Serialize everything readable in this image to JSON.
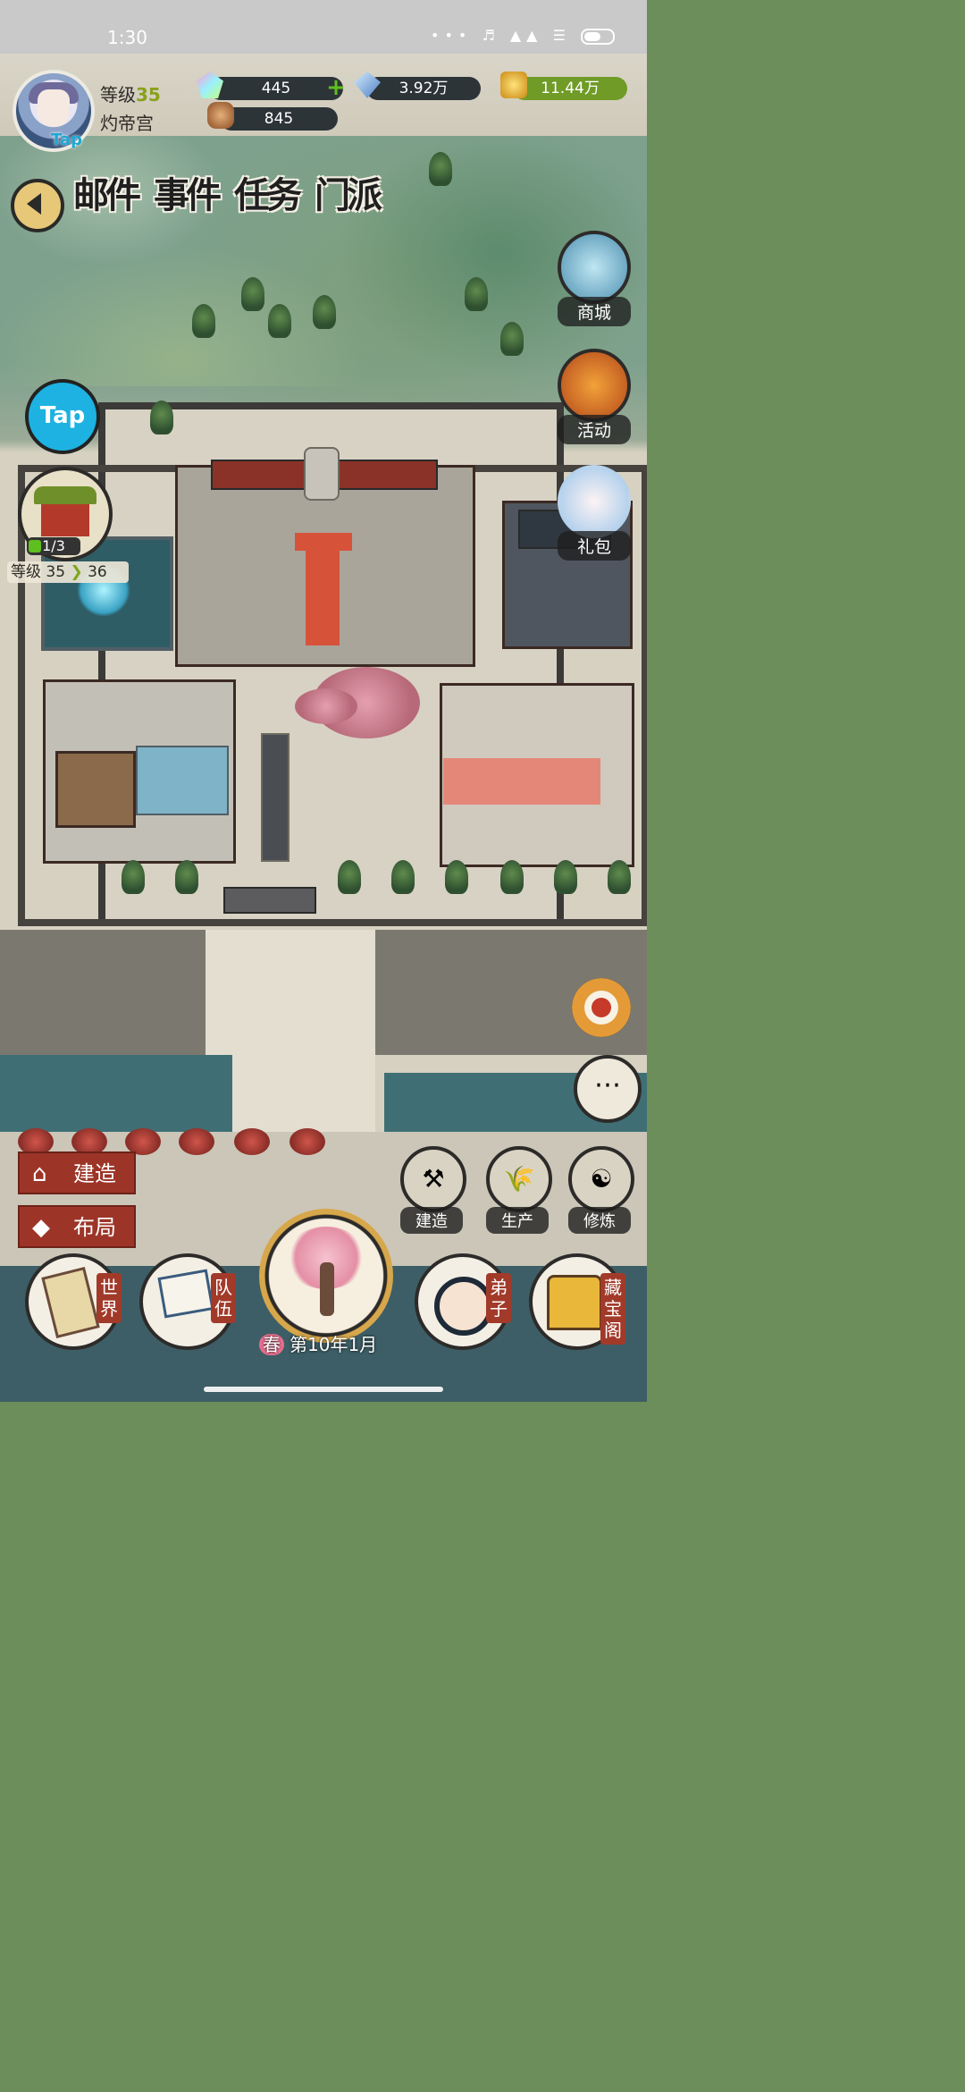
{
  "status_bar": {
    "time": "1:30"
  },
  "player": {
    "level_label": "等级",
    "level": "35",
    "sect_name": "灼帝宫",
    "avatar_badge": "Tap"
  },
  "resources": {
    "gems": "445",
    "crystal": "3.92万",
    "gold": "11.44万",
    "wood": "845"
  },
  "top_tabs": [
    "邮件",
    "事件",
    "任务",
    "门派"
  ],
  "side_right": {
    "shop": "商城",
    "event": "活动",
    "gift": "礼包"
  },
  "side_left": {
    "tap_button": "Tap",
    "progress": "1/3",
    "level_from_label": "等级 35",
    "level_to": "36"
  },
  "left_actions": {
    "build": "建造",
    "layout": "布局"
  },
  "right_actions": {
    "build": "建造",
    "produce": "生产",
    "cultivate": "修炼"
  },
  "bottom_nav": {
    "world": "世界",
    "team": "队伍",
    "disciples": "弟子",
    "treasure": "藏宝阁",
    "season": "春",
    "date": "第10年1月"
  },
  "colors": {
    "accent_red": "#9c3528",
    "resource_bar": "#2d3438",
    "gold_bar": "#6f9b26",
    "tap_blue": "#1db2e1"
  }
}
